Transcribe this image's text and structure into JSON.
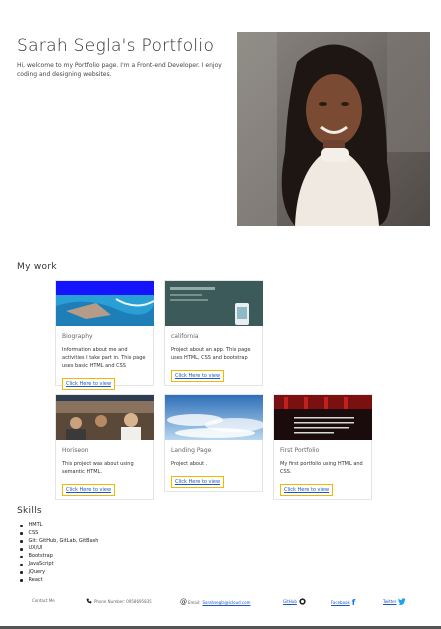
{
  "header": {
    "title": "Sarah Segla's Portfolio",
    "intro": "Hi, welcome to my Portfolio page. I'm a Front-end Developer. I enjoy coding and designing websites."
  },
  "work": {
    "title": "My work",
    "cards": [
      {
        "name": "Biography",
        "desc": "Information about me and activities I take part in. This page uses basic HTML and CSS",
        "link": "Click Here to view"
      },
      {
        "name": "california",
        "desc": "Project about an app. This page uses HTML, CSS and bootstrap",
        "link": "Click Here to view"
      },
      {
        "name": "Horiseon",
        "desc": "This project was about using semantic HTML.",
        "link": "Click Here to view"
      },
      {
        "name": "Landing Page",
        "desc": "Project about .",
        "link": "Click Here to view"
      },
      {
        "name": "First Portfolio",
        "desc": "My first portfolio using HTML and CSS.",
        "link": "Click Here to view"
      }
    ]
  },
  "skills": {
    "title": "Skills",
    "items": [
      "HMTL",
      "CSS",
      "Git: GitHub, GitLab, GitBash",
      "UX/UI",
      "Bootstrap",
      "JavaScript",
      "jQuery",
      "React"
    ]
  },
  "footer": {
    "contact": "Contact Me",
    "phone": "Phone Number: 0958695835",
    "email_label": "Email:",
    "email": "Sarahsegla@icloud.com",
    "github": "GitHub",
    "facebook": "Facebook",
    "twitter": "Twitter",
    "icons": [
      "phone-icon",
      "at-icon",
      "github-icon",
      "facebook-icon",
      "twitter-icon"
    ],
    "link_color": "#1a55c8"
  },
  "colors": {
    "link_border": "#f2b800",
    "facebook": "#1877f2",
    "twitter": "#1da1f2"
  }
}
